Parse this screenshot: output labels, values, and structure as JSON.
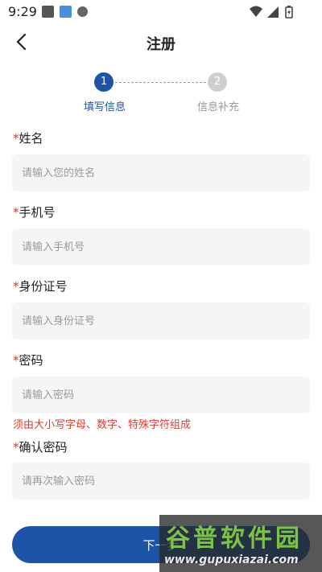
{
  "status_bar": {
    "time": "9:29",
    "icons": [
      "gallery-icon",
      "app-icon",
      "notification-icon",
      "wifi-icon",
      "signal-icon",
      "battery-icon"
    ]
  },
  "header": {
    "title": "注册",
    "back_icon": "chevron-left-icon"
  },
  "stepper": {
    "steps": [
      {
        "number": "1",
        "label": "填写信息",
        "active": true
      },
      {
        "number": "2",
        "label": "信息补充",
        "active": false
      }
    ]
  },
  "form": {
    "required_mark": "*",
    "fields": [
      {
        "label": "姓名",
        "placeholder": "请输入您的姓名",
        "value": ""
      },
      {
        "label": "手机号",
        "placeholder": "请输入手机号",
        "value": ""
      },
      {
        "label": "身份证号",
        "placeholder": "请输入身份证号",
        "value": ""
      },
      {
        "label": "密码",
        "placeholder": "请输入密码",
        "value": ""
      },
      {
        "label": "确认密码",
        "placeholder": "请再次输入密码",
        "value": ""
      }
    ],
    "password_hint": "须由大小写字母、数字、特殊字符组成"
  },
  "next_button": {
    "label": "下一步"
  },
  "watermark": {
    "title": "谷普软件园",
    "url": "www.gupuxiazai.com"
  },
  "colors": {
    "primary": "#1d54a8",
    "required": "#d9342b",
    "hint": "#e03a2f",
    "input_bg": "#f5f5f5",
    "inactive_step": "#cfcfcf"
  }
}
